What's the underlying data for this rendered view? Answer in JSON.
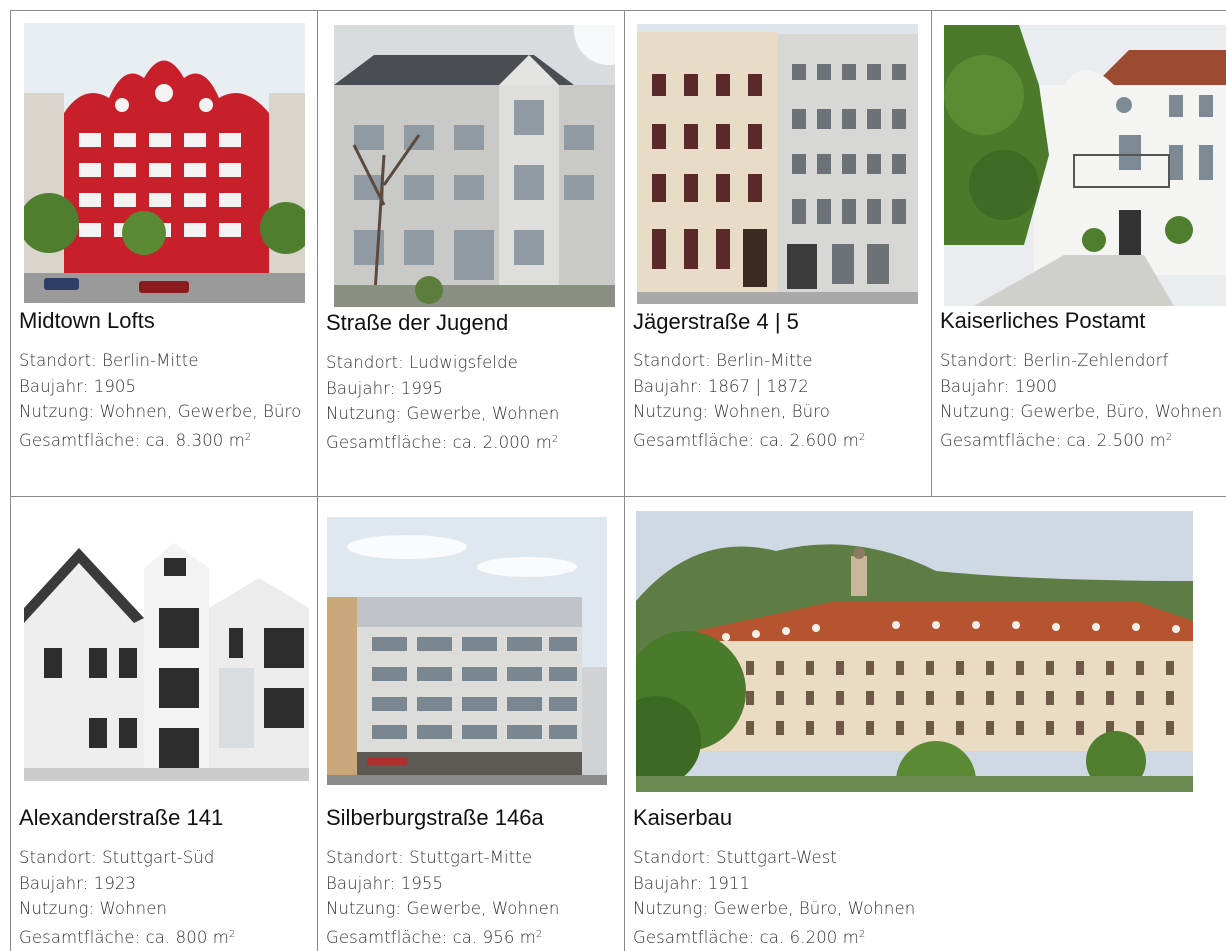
{
  "properties": [
    {
      "name": "Midtown Lofts",
      "standort": "Standort: Berlin-Mitte",
      "baujahr": "Baujahr: 1905",
      "nutzung": "Nutzung: Wohnen, Gewerbe, Büro",
      "flaeche": "Gesamtfläche: ca. 8.300 m",
      "photo_alt": "red-building-photo"
    },
    {
      "name": "Straße der Jugend",
      "standort": "Standort: Ludwigsfelde",
      "baujahr": "Baujahr: 1995",
      "nutzung": "Nutzung: Gewerbe, Wohnen",
      "flaeche": "Gesamtfläche: ca. 2.000 m",
      "photo_alt": "grey-building-photo"
    },
    {
      "name": "Jägerstraße 4 | 5",
      "standort": "Standort: Berlin-Mitte",
      "baujahr": "Baujahr: 1867 | 1872",
      "nutzung": "Nutzung: Wohnen, Büro",
      "flaeche": "Gesamtfläche: ca. 2.600 m",
      "photo_alt": "facade-building-photo"
    },
    {
      "name": "Kaiserliches Postamt",
      "standort": "Standort: Berlin-Zehlendorf",
      "baujahr": "Baujahr: 1900",
      "nutzung": "Nutzung: Gewerbe, Büro, Wohnen",
      "flaeche": "Gesamtfläche: ca. 2.500 m",
      "photo_alt": "white-villa-photo"
    },
    {
      "name": "Alexanderstraße 141",
      "standort": "Standort: Stuttgart-Süd",
      "baujahr": "Baujahr: 1923",
      "nutzung": "Nutzung: Wohnen",
      "flaeche": "Gesamtfläche: ca. 800 m",
      "photo_alt": "white-apartment-photo"
    },
    {
      "name": "Silberburgstraße 146a",
      "standort": "Standort: Stuttgart-Mitte",
      "baujahr": "Baujahr: 1955",
      "nutzung": "Nutzung: Gewerbe, Wohnen",
      "flaeche": "Gesamtfläche: ca. 956 m",
      "photo_alt": "office-building-photo"
    },
    {
      "name": "Kaiserbau",
      "standort": "Standort: Stuttgart-West",
      "baujahr": "Baujahr: 1911",
      "nutzung": "Nutzung: Gewerbe, Büro, Wohnen",
      "flaeche": "Gesamtfläche: ca. 6.200 m",
      "photo_alt": "large-historic-building-photo"
    }
  ],
  "unit_superscript": "2",
  "colors": {
    "grid": "#8a8a8a",
    "red_facade": "#c8202a",
    "roof": "#b5542e"
  }
}
